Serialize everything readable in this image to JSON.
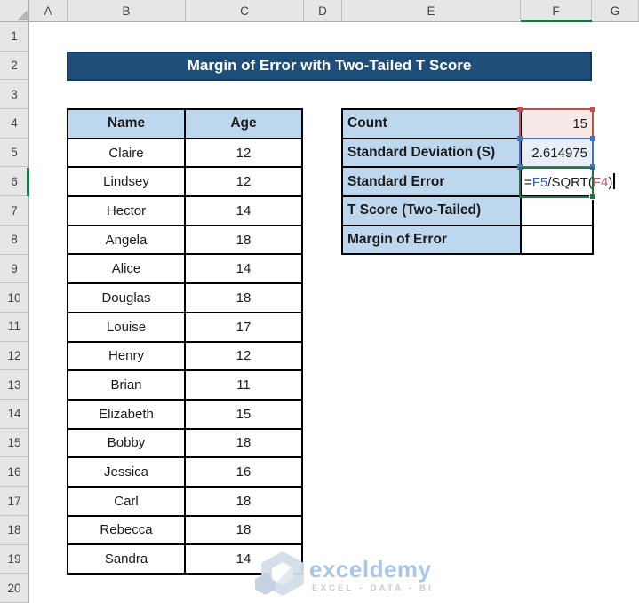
{
  "colors": {
    "banner_bg": "#1F4E79",
    "banner_border": "#16365C",
    "banner_text": "#FFFFFF",
    "header_fill": "#BDD7EE",
    "grid_border": "#000000",
    "ref_red": "#C0504D",
    "ref_red_fill": "#F6E9E8",
    "ref_blue": "#4472C4",
    "ref_blue_fill": "#E9EFF8",
    "active_green": "#217346",
    "formula_blue": "#3563B5",
    "formula_red": "#C45A5A",
    "watermark_blue": "#A9C6E9"
  },
  "grid": {
    "column_headers": [
      "A",
      "B",
      "C",
      "D",
      "E",
      "F",
      "G"
    ],
    "row_numbers": [
      "1",
      "2",
      "3",
      "4",
      "5",
      "6",
      "7",
      "8",
      "9",
      "10",
      "11",
      "12",
      "13",
      "14",
      "15",
      "16",
      "17",
      "18",
      "19",
      "20"
    ],
    "selected_column": "F",
    "selected_row": 6,
    "active_cell": "F6"
  },
  "title": {
    "text": "Margin of Error with Two-Tailed T Score"
  },
  "name_table": {
    "columns": [
      "Name",
      "Age"
    ],
    "rows": [
      [
        "Claire",
        "12"
      ],
      [
        "Lindsey",
        "12"
      ],
      [
        "Hector",
        "14"
      ],
      [
        "Angela",
        "18"
      ],
      [
        "Alice",
        "14"
      ],
      [
        "Douglas",
        "18"
      ],
      [
        "Louise",
        "17"
      ],
      [
        "Henry",
        "12"
      ],
      [
        "Brian",
        "11"
      ],
      [
        "Elizabeth",
        "15"
      ],
      [
        "Bobby",
        "18"
      ],
      [
        "Jessica",
        "16"
      ],
      [
        "Carl",
        "18"
      ],
      [
        "Rebecca",
        "18"
      ],
      [
        "Sandra",
        "14"
      ]
    ]
  },
  "stats_table": {
    "rows": [
      {
        "label": "Count",
        "value": "15",
        "highlight": "red"
      },
      {
        "label": "Standard Deviation (S)",
        "value": "2.614975",
        "highlight": "blue"
      },
      {
        "label": "Standard Error",
        "value": "",
        "highlight": "green",
        "formula": [
          {
            "text": "=",
            "color": "default"
          },
          {
            "text": "F5",
            "color": "blue"
          },
          {
            "text": "/SQRT(",
            "color": "default"
          },
          {
            "text": "F4",
            "color": "red"
          },
          {
            "text": ")",
            "color": "default"
          }
        ]
      },
      {
        "label": "T Score (Two-Tailed)",
        "value": "",
        "highlight": "none"
      },
      {
        "label": "Margin of Error",
        "value": "",
        "highlight": "none"
      }
    ]
  },
  "watermark": {
    "brand": "exceldemy",
    "tagline": "EXCEL - DATA - BI"
  }
}
